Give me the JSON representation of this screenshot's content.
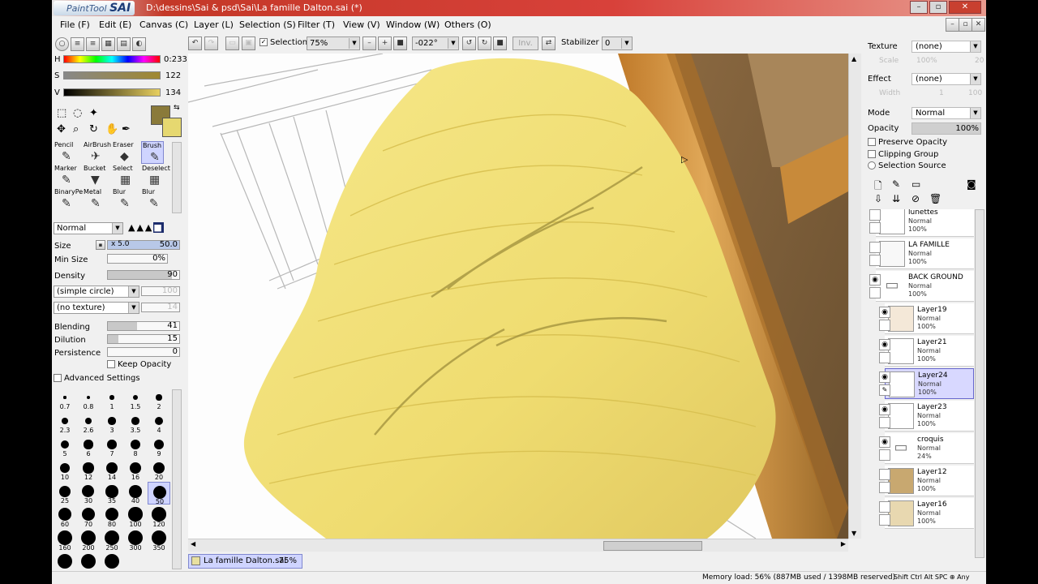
{
  "app": {
    "logo_small": "PaintTool",
    "logo_big": "SAI",
    "title": "D:\\dessins\\Sai & psd\\Sai\\La famille Dalton.sai (*)"
  },
  "menu": [
    "File (F)",
    "Edit (E)",
    "Canvas (C)",
    "Layer (L)",
    "Selection (S)",
    "Filter (T)",
    "View (V)",
    "Window (W)",
    "Others (O)"
  ],
  "toolbar": {
    "selection_label": "Selection",
    "zoom": "75%",
    "angle": "-022°",
    "inv_label": "Inv.",
    "stabilizer_label": "Stabilizer",
    "stabilizer_value": "0"
  },
  "color": {
    "h_label": "H",
    "h_value": "0:233",
    "s_label": "S",
    "s_value": "122",
    "v_label": "V",
    "v_value": "134",
    "primary": "#8a7a3a",
    "secondary": "#e6d870"
  },
  "tools": [
    {
      "name": "Pencil",
      "glyph": "✎"
    },
    {
      "name": "AirBrush",
      "glyph": "✈"
    },
    {
      "name": "Eraser",
      "glyph": "◆"
    },
    {
      "name": "Brush",
      "glyph": "✎"
    },
    {
      "name": "Marker",
      "glyph": "✎"
    },
    {
      "name": "Bucket",
      "glyph": "▼"
    },
    {
      "name": "Select",
      "glyph": "▦"
    },
    {
      "name": "Deselect",
      "glyph": "▦"
    },
    {
      "name": "BinaryPe",
      "glyph": "✎"
    },
    {
      "name": "Metal",
      "glyph": "✎"
    },
    {
      "name": "Blur",
      "glyph": "✎"
    },
    {
      "name": "Blur",
      "glyph": "✎"
    }
  ],
  "brush": {
    "mode": "Normal",
    "size_label": "Size",
    "size_mult": "x 5.0",
    "size_value": "50.0",
    "size_fraction": 1.0,
    "minsize_label": "Min Size",
    "minsize_value": "0%",
    "minsize_fraction": 0.0,
    "density_label": "Density",
    "density_value": "90",
    "density_fraction": 0.9,
    "shape": "(simple circle)",
    "shape_value": "100",
    "texture": "(no texture)",
    "texture_value": "14",
    "blending_label": "Blending",
    "blending_value": "41",
    "blending_fraction": 0.41,
    "dilution_label": "Dilution",
    "dilution_value": "15",
    "dilution_fraction": 0.15,
    "persistence_label": "Persistence",
    "persistence_value": "0",
    "persistence_fraction": 0.0,
    "keep_opacity": "Keep Opacity",
    "advanced": "Advanced Settings"
  },
  "brush_sizes": [
    "0.7",
    "0.8",
    "1",
    "1.5",
    "2",
    "2.3",
    "2.6",
    "3",
    "3.5",
    "4",
    "5",
    "6",
    "7",
    "8",
    "9",
    "10",
    "12",
    "14",
    "16",
    "20",
    "25",
    "30",
    "35",
    "40",
    "50",
    "60",
    "70",
    "80",
    "100",
    "120",
    "160",
    "200",
    "250",
    "300",
    "350",
    "",
    "",
    ""
  ],
  "right": {
    "texture_label": "Texture",
    "texture_value": "(none)",
    "scale_label": "Scale",
    "scale_value": "100%",
    "scale_num": "20",
    "effect_label": "Effect",
    "effect_value": "(none)",
    "width_label": "Width",
    "width_value": "1",
    "width_num": "100",
    "mode_label": "Mode",
    "mode_value": "Normal",
    "opacity_label": "Opacity",
    "opacity_value": "100%",
    "preserve": "Preserve Opacity",
    "clipping": "Clipping Group",
    "selsource": "Selection Source"
  },
  "layers": [
    {
      "name": "lunettes",
      "mode": "Normal",
      "opacity": "100%"
    },
    {
      "name": "LA FAMILLE",
      "mode": "Normal",
      "opacity": "100%"
    },
    {
      "name": "BACK GROUND",
      "mode": "Normal",
      "opacity": "100%"
    },
    {
      "name": "Layer19",
      "mode": "Normal",
      "opacity": "100%"
    },
    {
      "name": "Layer21",
      "mode": "Normal",
      "opacity": "100%"
    },
    {
      "name": "Layer24",
      "mode": "Normal",
      "opacity": "100%"
    },
    {
      "name": "Layer23",
      "mode": "Normal",
      "opacity": "100%"
    },
    {
      "name": "croquis",
      "mode": "Normal",
      "opacity": "24%"
    },
    {
      "name": "Layer12",
      "mode": "Normal",
      "opacity": "100%"
    },
    {
      "name": "Layer16",
      "mode": "Normal",
      "opacity": "100%"
    }
  ],
  "doc_tab": {
    "name": "La famille Dalton.sai",
    "zoom": "75%"
  },
  "status": {
    "memory": "Memory load: 56% (887MB used / 1398MB reserved)",
    "keys": "Shift Ctrl Alt SPC ⊕ Any"
  }
}
